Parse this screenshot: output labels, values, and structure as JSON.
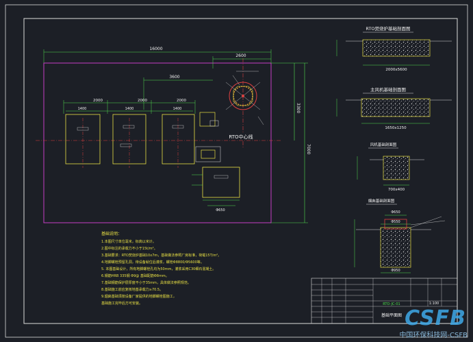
{
  "plan": {
    "overall_width": "16000",
    "top_dim": "2600",
    "dim_3600": "3600",
    "dim_2000_a": "2000",
    "dim_2000_b": "2000",
    "dim_2000_c": "2000",
    "dim_1400_a": "1400",
    "dim_1400_b": "1400",
    "dim_1400_c": "1400",
    "right_dim_a": "3300",
    "right_dim_b": "7000",
    "rto_label": "RTO中心线",
    "dim_650": "Φ650"
  },
  "sections": {
    "s1_title": "RTO焚烧炉基础剖面图",
    "s1_dim": "2000x5600",
    "s2_title": "主风机基础剖面图",
    "s2_dim": "1650x1250",
    "s3_title": "风机基础剖面图",
    "s3_dim": "700x400",
    "s4_title": "烟囱基础剖面图",
    "s4_dim_a": "Φ650",
    "s4_dim_b": "Φ550",
    "s4_dim_c": "Φ950"
  },
  "notes": {
    "title": "基础说明：",
    "lines": [
      "1.本图尺寸单位毫米，标高以米计。",
      "2.图中标注的承载力不小于15t/m²。",
      "3.基础要求：RTO焚烧炉基础10x7m，基础做法参照厂房标准，荷载15T/m²。",
      "4.地脚螺栓预留孔洞，待设备就位后灌浆，螺栓Φ8800/Φ5600等。",
      "5.  本图基础设计，所有地脚螺栓孔均为50mm，灌浆采用C30细石混凝土。",
      "6.钢筋HRB 335钢   Φ9@   基础配筋Φ8mm。",
      "7.基础钢筋保护层厚度不小于35mm，具体做法参照规范。",
      "8.基础施工前应复核地基承载力≥70.5。",
      "9.烟囱基础须按设备厂家提供的地脚螺栓图施工，",
      "  基础施工完毕后方可安装。"
    ]
  },
  "title_block": {
    "drawing_no": "RTO-JC-01",
    "name": "基础平面图",
    "scale": "1:100"
  },
  "watermark": {
    "logo": "CSFB",
    "text": "中国环保科技网-CSFB"
  }
}
